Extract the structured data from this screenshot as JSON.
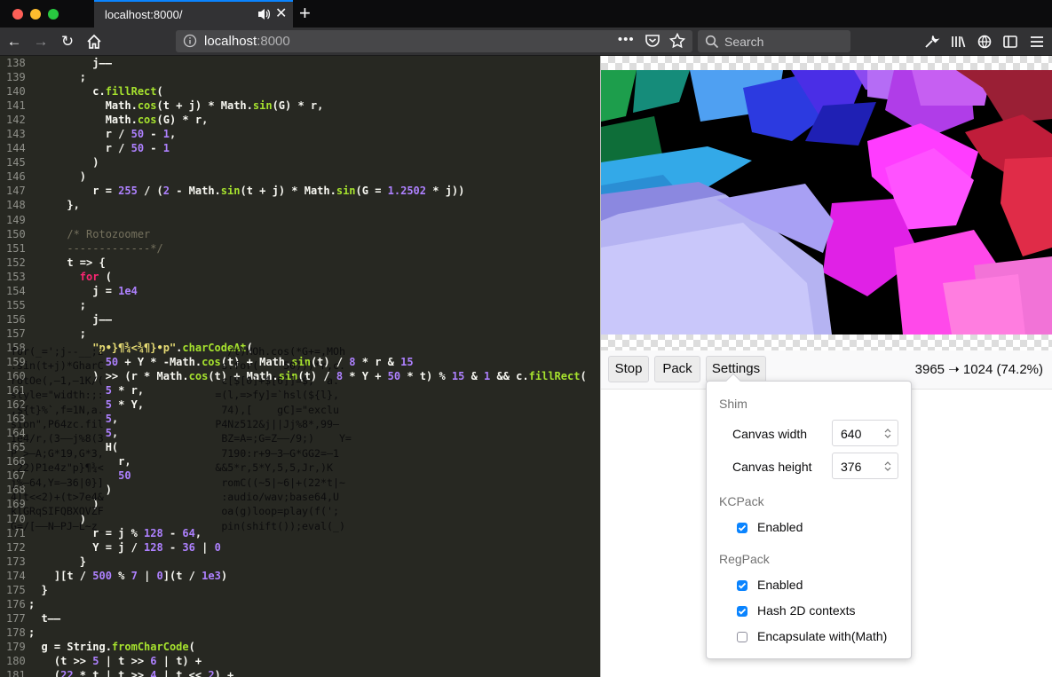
{
  "window": {
    "tab_title": "localhost:8000/"
  },
  "urlbar": {
    "host": "localhost",
    "port": ":8000",
    "actions": "•••"
  },
  "search": {
    "placeholder": "Search"
  },
  "code_lines": [
    {
      "n": "138",
      "t": "          j——"
    },
    {
      "n": "139",
      "t": "        ;"
    },
    {
      "n": "140",
      "t": "          c.fillRect("
    },
    {
      "n": "141",
      "t": "            Math.cos(t + j) * Math.sin(G) * r,"
    },
    {
      "n": "142",
      "t": "            Math.cos(G) * r,"
    },
    {
      "n": "143",
      "t": "            r / 50 - 1,"
    },
    {
      "n": "144",
      "t": "            r / 50 - 1"
    },
    {
      "n": "145",
      "t": "          )"
    },
    {
      "n": "146",
      "t": "        )"
    },
    {
      "n": "147",
      "t": "          r = 255 / (2 - Math.sin(t + j) * Math.sin(G = 1.2502 * j))"
    },
    {
      "n": "148",
      "t": "      },"
    },
    {
      "n": "149",
      "t": ""
    },
    {
      "n": "150",
      "t": "      /* Rotozoomer"
    },
    {
      "n": "151",
      "t": "      -------------*/"
    },
    {
      "n": "152",
      "t": "      t => {"
    },
    {
      "n": "153",
      "t": "        for ("
    },
    {
      "n": "154",
      "t": "          j = 1e4"
    },
    {
      "n": "155",
      "t": "        ;"
    },
    {
      "n": "156",
      "t": "          j——"
    },
    {
      "n": "157",
      "t": "        ;"
    },
    {
      "n": "158",
      "t": "          \"p•}¶¾<¾¶}•p\".charCodeAt("
    },
    {
      "n": "159",
      "t": "            50 + Y * -Math.cos(t) + Math.sin(t) / 8 * r & 15"
    },
    {
      "n": "160",
      "t": "          ) >> (r * Math.cos(t) + Math.sin(t) / 8 * Y + 50 * t) % 15 & 1 && c.fillRect("
    },
    {
      "n": "161",
      "t": "            5 * r,"
    },
    {
      "n": "162",
      "t": "            5 * Y,"
    },
    {
      "n": "163",
      "t": "            5,"
    },
    {
      "n": "164",
      "t": "            5,"
    },
    {
      "n": "165",
      "t": "            H("
    },
    {
      "n": "166",
      "t": "              r,"
    },
    {
      "n": "167",
      "t": "              50"
    },
    {
      "n": "168",
      "t": "            )"
    },
    {
      "n": "169",
      "t": "          )"
    },
    {
      "n": "170",
      "t": "        )"
    },
    {
      "n": "171",
      "t": "          r = j % 128 - 64,"
    },
    {
      "n": "172",
      "t": "          Y = j / 128 - 36 | 0"
    },
    {
      "n": "173",
      "t": "        }"
    },
    {
      "n": "174",
      "t": "    ][t / 500 % 7 | 0](t / 1e3)"
    },
    {
      "n": "175",
      "t": "  }"
    },
    {
      "n": "176",
      "t": ";"
    },
    {
      "n": "177",
      "t": "  t——"
    },
    {
      "n": "178",
      "t": ";"
    },
    {
      "n": "179",
      "t": "  g = String.fromCharCode("
    },
    {
      "n": "180",
      "t": "    (t >> 5 | t >> 6 | t) +"
    },
    {
      "n": "181",
      "t": "    (22 * t | t >> 4 | t << 2) +"
    }
  ],
  "toolbar": {
    "stop": "Stop",
    "pack": "Pack",
    "settings": "Settings",
    "stats": "3965 ➝ 1024 (74.2%)"
  },
  "output_lines": [
    "for(_=';j--__;z                    /t)MOh.cos(*G+=,MOh",
    ".sin(t+j)*GharC                   s.for(    50)))*r,c.",
    "rotOe(,—1,—1K/(                   c[$[0]+$[6]]=$;  a.",
    "style=\"width:;:                  =(l,=>fy]=`hsl(${l},",
    ",${t}%`,f=1N,a.                   74),[    gC]=\"exclu",
    "sion\",P64zc.fil                  P4Nz512&j||Jj%8*,99—",
    "1e4/r,(3——j%8(3                   BZ=A=;G=Z——/9;)    Y=",
    "P_>—A;G*19,G*3,                   7190:r+9—3—G*GG2=—1",
    ".22)P1e4z\"p}¶¾<                  &&5*r,5*Y,5,5,Jr,)K",
    "j%—64,Y=—36|0}]                   romC((~5|~6|+(22*t|~",
    "4|t<<2)+(t>7e4&                   :audio/wav;base64,U",
    "klGRqSIFQBXQVZF                   oa(g)loop=play(f(';",
    "G=/[——N—PJ—L~z_                   pin(shift());eval(_)"
  ],
  "settings": {
    "shim_title": "Shim",
    "canvas_width_label": "Canvas width",
    "canvas_width": "640",
    "canvas_height_label": "Canvas height",
    "canvas_height": "376",
    "kcpack_title": "KCPack",
    "kcpack_enabled_label": "Enabled",
    "kcpack_enabled": true,
    "regpack_title": "RegPack",
    "regpack_enabled_label": "Enabled",
    "regpack_enabled": true,
    "hash_label": "Hash 2D contexts",
    "hash_enabled": true,
    "encap_label": "Encapsulate with(Math)",
    "encap_enabled": false
  },
  "colors": {
    "accent": "#0a84ff",
    "editor_bg": "#272822",
    "keyword": "#f92672",
    "function": "#a6e22e",
    "number": "#ae81ff",
    "string": "#e6db74",
    "comment": "#75715e"
  },
  "icons": [
    "back-icon",
    "forward-icon",
    "reload-icon",
    "home-icon",
    "info-icon",
    "pocket-icon",
    "bookmark-star-icon",
    "search-icon",
    "wrench-icon",
    "library-icon",
    "sync-icon",
    "sidebar-icon",
    "menu-icon",
    "audio-icon",
    "close-icon"
  ]
}
